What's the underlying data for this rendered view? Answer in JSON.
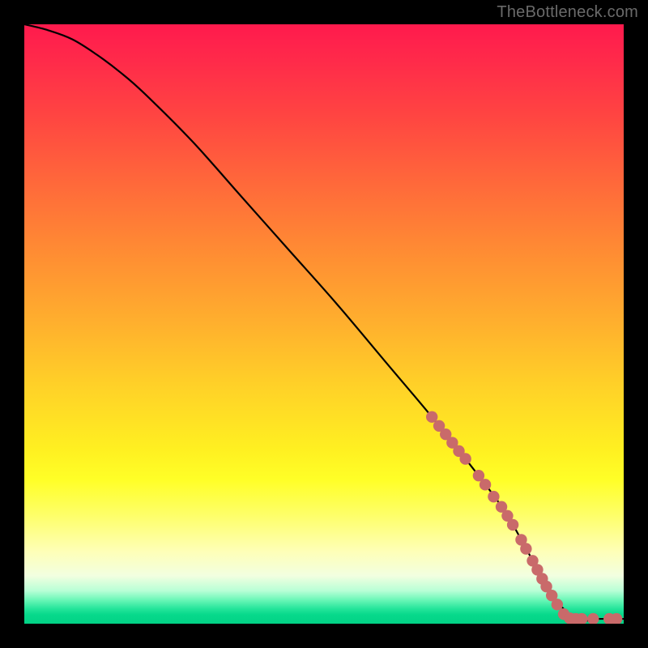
{
  "watermark": "TheBottleneck.com",
  "chart_data": {
    "type": "line",
    "title": "",
    "xlabel": "",
    "ylabel": "",
    "xlim": [
      0,
      100
    ],
    "ylim": [
      0,
      100
    ],
    "curve": {
      "name": "bottleneck-curve",
      "x": [
        0,
        4,
        8,
        12,
        16,
        20,
        28,
        36,
        44,
        52,
        60,
        68,
        74,
        80,
        84,
        88,
        92,
        96,
        100
      ],
      "y": [
        100,
        99,
        97.5,
        95,
        92,
        88.5,
        80.5,
        71.5,
        62.5,
        53.5,
        44,
        34.5,
        27,
        19,
        12,
        5,
        0.8,
        0.8,
        0.8
      ]
    },
    "markers": {
      "name": "highlighted-points",
      "color": "#c96a6a",
      "points": [
        {
          "x": 68.0,
          "y": 34.5
        },
        {
          "x": 69.2,
          "y": 33.0
        },
        {
          "x": 70.3,
          "y": 31.6
        },
        {
          "x": 71.4,
          "y": 30.2
        },
        {
          "x": 72.5,
          "y": 28.8
        },
        {
          "x": 73.6,
          "y": 27.5
        },
        {
          "x": 75.8,
          "y": 24.7
        },
        {
          "x": 76.9,
          "y": 23.2
        },
        {
          "x": 78.3,
          "y": 21.2
        },
        {
          "x": 79.6,
          "y": 19.5
        },
        {
          "x": 80.6,
          "y": 18.0
        },
        {
          "x": 81.5,
          "y": 16.5
        },
        {
          "x": 82.9,
          "y": 14.0
        },
        {
          "x": 83.7,
          "y": 12.5
        },
        {
          "x": 84.8,
          "y": 10.5
        },
        {
          "x": 85.6,
          "y": 9.0
        },
        {
          "x": 86.4,
          "y": 7.5
        },
        {
          "x": 87.1,
          "y": 6.2
        },
        {
          "x": 88.0,
          "y": 4.7
        },
        {
          "x": 88.9,
          "y": 3.2
        },
        {
          "x": 90.0,
          "y": 1.6
        },
        {
          "x": 91.0,
          "y": 0.9
        },
        {
          "x": 92.0,
          "y": 0.8
        },
        {
          "x": 93.0,
          "y": 0.8
        },
        {
          "x": 94.9,
          "y": 0.8
        },
        {
          "x": 97.6,
          "y": 0.8
        },
        {
          "x": 98.8,
          "y": 0.8
        }
      ]
    },
    "gradient": {
      "stops": [
        {
          "pos": 0,
          "color": "#ff1a4d"
        },
        {
          "pos": 0.5,
          "color": "#ffd028"
        },
        {
          "pos": 0.78,
          "color": "#ffff27"
        },
        {
          "pos": 0.97,
          "color": "#25e59a"
        },
        {
          "pos": 1.0,
          "color": "#02d286"
        }
      ]
    }
  }
}
